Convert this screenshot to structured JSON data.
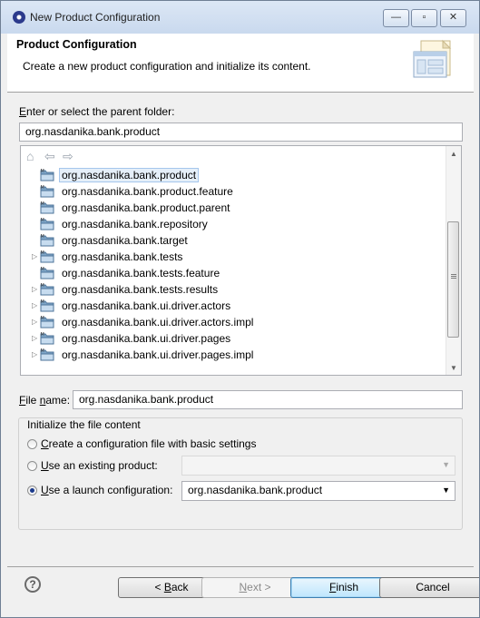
{
  "window": {
    "title": "New Product Configuration",
    "minimize_glyph": "—",
    "restore_glyph": "▫",
    "close_glyph": "✕"
  },
  "header": {
    "title": "Product Configuration",
    "description": "Create a new product configuration and initialize its content."
  },
  "parent_folder": {
    "label_first": "E",
    "label_rest": "nter or select the parent folder:",
    "value": "org.nasdanika.bank.product"
  },
  "tree": {
    "toolbar": {
      "home_glyph": "⌂",
      "back_glyph": "⇦",
      "forward_glyph": "⇨"
    },
    "items": [
      {
        "label": "org.nasdanika.bank.product",
        "expandable": false,
        "selected": true
      },
      {
        "label": "org.nasdanika.bank.product.feature",
        "expandable": false,
        "selected": false
      },
      {
        "label": "org.nasdanika.bank.product.parent",
        "expandable": false,
        "selected": false
      },
      {
        "label": "org.nasdanika.bank.repository",
        "expandable": false,
        "selected": false
      },
      {
        "label": "org.nasdanika.bank.target",
        "expandable": false,
        "selected": false
      },
      {
        "label": "org.nasdanika.bank.tests",
        "expandable": true,
        "selected": false
      },
      {
        "label": "org.nasdanika.bank.tests.feature",
        "expandable": false,
        "selected": false
      },
      {
        "label": "org.nasdanika.bank.tests.results",
        "expandable": true,
        "selected": false
      },
      {
        "label": "org.nasdanika.bank.ui.driver.actors",
        "expandable": true,
        "selected": false
      },
      {
        "label": "org.nasdanika.bank.ui.driver.actors.impl",
        "expandable": true,
        "selected": false
      },
      {
        "label": "org.nasdanika.bank.ui.driver.pages",
        "expandable": true,
        "selected": false
      },
      {
        "label": "org.nasdanika.bank.ui.driver.pages.impl",
        "expandable": true,
        "selected": false
      }
    ],
    "twisty_glyph": "▷",
    "scroll_up_glyph": "▲",
    "scroll_down_glyph": "▼"
  },
  "file_name": {
    "label_first": "F",
    "label_mid": "ile ",
    "label_u": "n",
    "label_rest": "ame:",
    "value": "org.nasdanika.bank.product"
  },
  "init_group": {
    "title": "Initialize the file content",
    "options": [
      {
        "first": "C",
        "rest": "reate a configuration file with basic settings",
        "checked": false
      },
      {
        "first": "U",
        "rest": "se an existing product:",
        "checked": false
      },
      {
        "first": "U",
        "rest": "se a launch configuration:",
        "checked": true
      }
    ],
    "existing_product_value": "",
    "launch_configuration_value": "org.nasdanika.bank.product",
    "combo_arrow_glyph": "▼"
  },
  "footer": {
    "help_glyph": "?",
    "back": {
      "prefix": "< ",
      "u": "B",
      "rest": "ack"
    },
    "next": {
      "u": "N",
      "rest": "ext >"
    },
    "finish": {
      "u": "F",
      "rest": "inish"
    },
    "cancel": "Cancel"
  },
  "colors": {
    "title_gradient_top": "#dce7f5",
    "selection_bg": "#e5eff9",
    "default_button": "#bee6fd"
  }
}
